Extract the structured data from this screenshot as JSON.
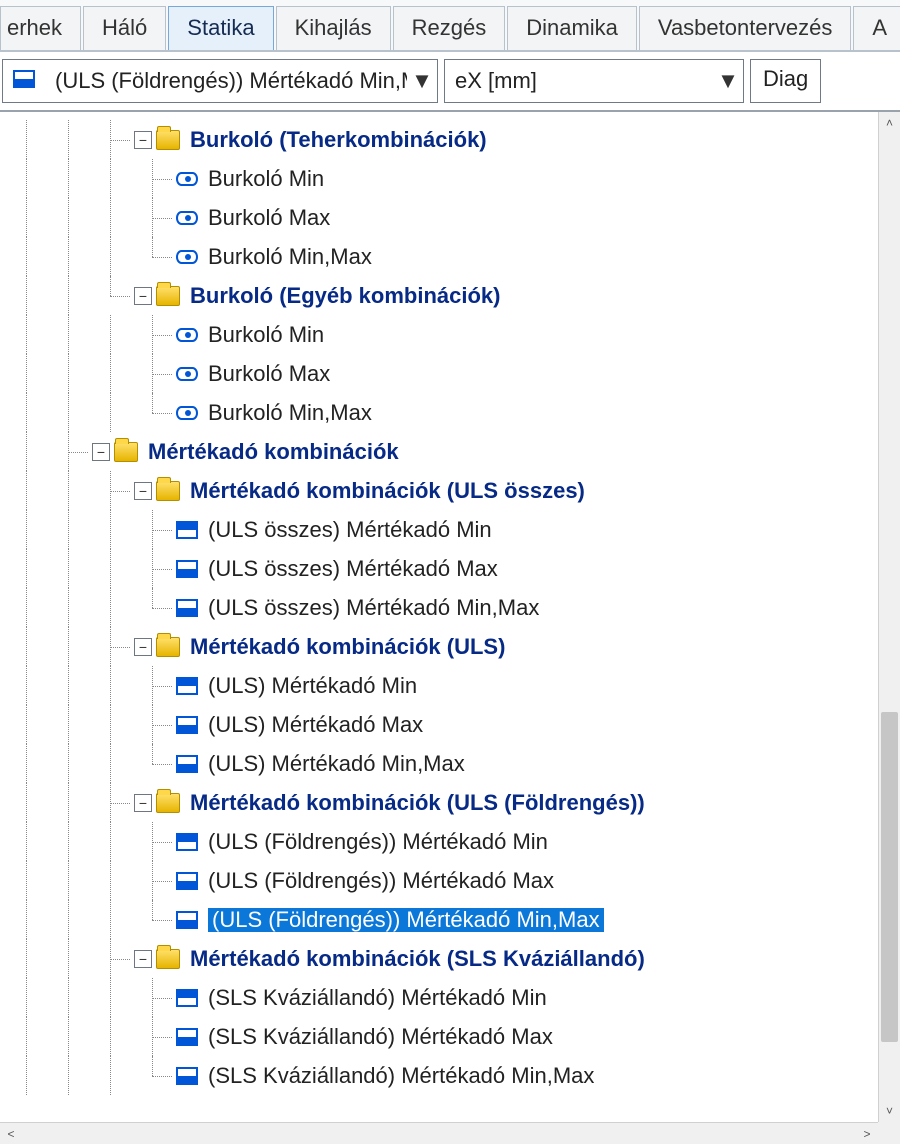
{
  "tabs": {
    "items": [
      "erhek",
      "Háló",
      "Statika",
      "Kihajlás",
      "Rezgés",
      "Dinamika",
      "Vasbetontervezés",
      "A"
    ],
    "active_index": 2
  },
  "toolbar": {
    "combo1_value": "(ULS (Földrengés)) Mértékadó Min,M",
    "combo2_value": "eX [mm]",
    "right_label": "Diag"
  },
  "tree": [
    {
      "level": 2,
      "type": "folder",
      "toggle": "-",
      "label": "Burkoló (Teherkombinációk)",
      "bold": true,
      "joints": [
        0,
        1,
        1
      ]
    },
    {
      "level": 3,
      "type": "eye",
      "label": "Burkoló Min",
      "joints": [
        0,
        1,
        1,
        1
      ]
    },
    {
      "level": 3,
      "type": "eye",
      "label": "Burkoló Max",
      "joints": [
        0,
        1,
        1,
        1
      ]
    },
    {
      "level": 3,
      "type": "eye",
      "label": "Burkoló Min,Max",
      "joints": [
        0,
        1,
        1,
        2
      ]
    },
    {
      "level": 2,
      "type": "folder",
      "toggle": "-",
      "label": "Burkoló (Egyéb kombinációk)",
      "bold": true,
      "joints": [
        0,
        1,
        2
      ]
    },
    {
      "level": 3,
      "type": "eye",
      "label": "Burkoló Min",
      "joints": [
        0,
        1,
        0,
        1
      ]
    },
    {
      "level": 3,
      "type": "eye",
      "label": "Burkoló Max",
      "joints": [
        0,
        1,
        0,
        1
      ]
    },
    {
      "level": 3,
      "type": "eye",
      "label": "Burkoló Min,Max",
      "joints": [
        0,
        1,
        0,
        2
      ]
    },
    {
      "level": 1,
      "type": "folder",
      "toggle": "-",
      "label": "Mértékadó kombinációk",
      "bold": true,
      "joints": [
        0,
        1
      ]
    },
    {
      "level": 2,
      "type": "folder",
      "toggle": "-",
      "label": "Mértékadó kombinációk (ULS összes)",
      "bold": true,
      "joints": [
        0,
        1,
        1
      ]
    },
    {
      "level": 3,
      "type": "item",
      "sub": "top",
      "label": "(ULS összes) Mértékadó Min",
      "joints": [
        0,
        1,
        1,
        1
      ]
    },
    {
      "level": 3,
      "type": "item",
      "sub": "half",
      "label": "(ULS összes) Mértékadó Max",
      "joints": [
        0,
        1,
        1,
        1
      ]
    },
    {
      "level": 3,
      "type": "item",
      "sub": "half",
      "label": "(ULS összes) Mértékadó Min,Max",
      "joints": [
        0,
        1,
        1,
        2
      ]
    },
    {
      "level": 2,
      "type": "folder",
      "toggle": "-",
      "label": "Mértékadó kombinációk (ULS)",
      "bold": true,
      "joints": [
        0,
        1,
        1
      ]
    },
    {
      "level": 3,
      "type": "item",
      "sub": "top",
      "label": "(ULS) Mértékadó Min",
      "joints": [
        0,
        1,
        1,
        1
      ]
    },
    {
      "level": 3,
      "type": "item",
      "sub": "half",
      "label": "(ULS) Mértékadó Max",
      "joints": [
        0,
        1,
        1,
        1
      ]
    },
    {
      "level": 3,
      "type": "item",
      "sub": "half",
      "label": "(ULS) Mértékadó Min,Max",
      "joints": [
        0,
        1,
        1,
        2
      ]
    },
    {
      "level": 2,
      "type": "folder",
      "toggle": "-",
      "label": "Mértékadó kombinációk (ULS (Földrengés))",
      "bold": true,
      "joints": [
        0,
        1,
        1
      ]
    },
    {
      "level": 3,
      "type": "item",
      "sub": "top",
      "label": "(ULS (Földrengés)) Mértékadó Min",
      "joints": [
        0,
        1,
        1,
        1
      ]
    },
    {
      "level": 3,
      "type": "item",
      "sub": "half",
      "label": "(ULS (Földrengés)) Mértékadó Max",
      "joints": [
        0,
        1,
        1,
        1
      ]
    },
    {
      "level": 3,
      "type": "item",
      "sub": "half",
      "label": "(ULS (Földrengés)) Mértékadó Min,Max",
      "joints": [
        0,
        1,
        1,
        2
      ],
      "selected": true
    },
    {
      "level": 2,
      "type": "folder",
      "toggle": "-",
      "label": "Mértékadó kombinációk (SLS Kváziállandó)",
      "bold": true,
      "joints": [
        0,
        1,
        1
      ]
    },
    {
      "level": 3,
      "type": "item",
      "sub": "top",
      "label": "(SLS Kváziállandó) Mértékadó Min",
      "joints": [
        0,
        1,
        1,
        1
      ]
    },
    {
      "level": 3,
      "type": "item",
      "sub": "half",
      "label": "(SLS Kváziállandó) Mértékadó Max",
      "joints": [
        0,
        1,
        1,
        1
      ]
    },
    {
      "level": 3,
      "type": "item",
      "sub": "half",
      "label": "(SLS Kváziállandó) Mértékadó Min,Max",
      "joints": [
        0,
        1,
        1,
        2
      ]
    }
  ]
}
